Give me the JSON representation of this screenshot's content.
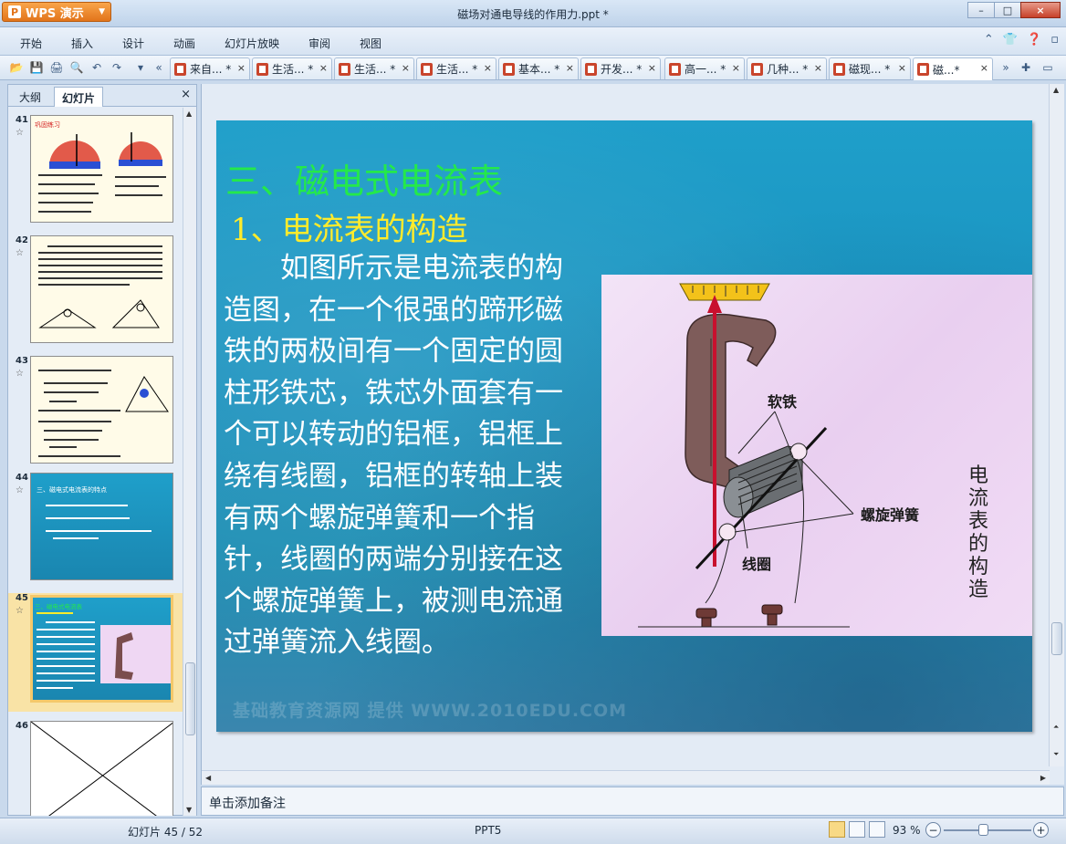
{
  "window": {
    "app_label": "WPS 演示",
    "doc_title": "磁场对通电导线的作用力.ppt *",
    "minimize_label": "–",
    "maximize_label": "□",
    "close_label": "×"
  },
  "menu": {
    "items": [
      "开始",
      "插入",
      "设计",
      "动画",
      "幻灯片放映",
      "审阅",
      "视图"
    ]
  },
  "tabs": [
    {
      "label": "来自... *"
    },
    {
      "label": "生活... *"
    },
    {
      "label": "生活... *"
    },
    {
      "label": "生活... *"
    },
    {
      "label": "基本... *"
    },
    {
      "label": "开发... *"
    },
    {
      "label": "高一... *"
    },
    {
      "label": "几种... *"
    },
    {
      "label": "磁现... *"
    },
    {
      "label": "磁...*"
    }
  ],
  "panel": {
    "tab_outline": "大纲",
    "tab_slides": "幻灯片",
    "close_label": "×",
    "thumbs": [
      {
        "num": "41",
        "star": "☆",
        "caption": "巩固练习"
      },
      {
        "num": "42",
        "star": "☆",
        "caption": ""
      },
      {
        "num": "43",
        "star": "☆",
        "caption": ""
      },
      {
        "num": "44",
        "star": "☆",
        "caption": "三、磁电式电流表的特点"
      },
      {
        "num": "45",
        "star": "☆",
        "caption": "三、磁电式电流表"
      },
      {
        "num": "46",
        "star": "",
        "caption": ""
      }
    ]
  },
  "slide": {
    "title": "三、磁电式电流表",
    "subtitle": "1、电流表的构造",
    "body": "如图所示是电流表的构造图，在一个很强的蹄形磁铁的两极间有一个固定的圆柱形铁芯，铁芯外面套有一个可以转动的铝框，铝框上绕有线圈，铝框的转轴上装有两个螺旋弹簧和一个指针，线圈的两端分别接在这个螺旋弹簧上，被测电流通过弹簧流入线圈。",
    "watermark": "基础教育资源网 提供  WWW.2010EDU.COM",
    "figure_caption": "电流表的构造",
    "figure_labels": {
      "soft_iron": "软铁",
      "spring": "螺旋弹簧",
      "coil": "线圈"
    }
  },
  "notes": {
    "placeholder": "单击添加备注"
  },
  "status": {
    "slide_info": "幻灯片 45 / 52",
    "theme": "PPT5",
    "zoom": "93 %",
    "zoom_minus": "−",
    "zoom_plus": "+"
  },
  "colors": {
    "slide_bg": "#1f9fca",
    "title_green": "#24e94a",
    "subtitle_yellow": "#ffeb2b",
    "app_orange": "#e2741b"
  }
}
